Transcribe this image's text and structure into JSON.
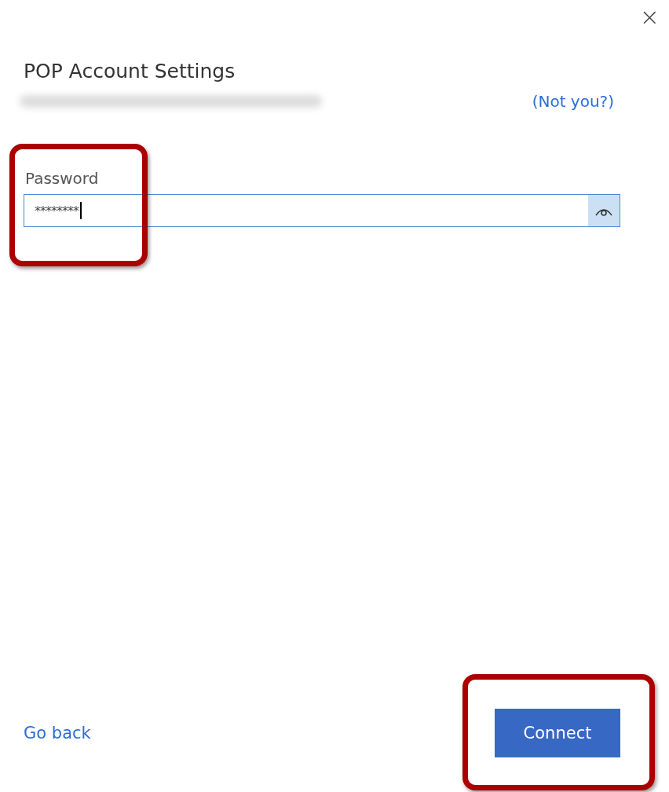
{
  "dialog": {
    "close": "×",
    "title": "POP Account Settings",
    "not_you_link": "(Not you?)"
  },
  "password": {
    "label": "Password",
    "value": "********",
    "focused": true
  },
  "footer": {
    "back_link": "Go back",
    "connect_button": "Connect"
  }
}
